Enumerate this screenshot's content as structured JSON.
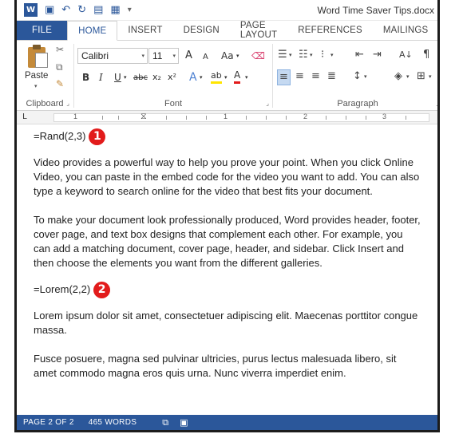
{
  "app": {
    "title": "Word Time Saver Tips.docx",
    "logo_letter": "W"
  },
  "qat": {
    "save_icon": "▣",
    "undo_icon": "↶",
    "redo_icon": "↻",
    "print_icon": "▤",
    "table_icon": "▦",
    "customize_icon": "▾"
  },
  "tabs": [
    {
      "label": "FILE"
    },
    {
      "label": "HOME"
    },
    {
      "label": "INSERT"
    },
    {
      "label": "DESIGN"
    },
    {
      "label": "PAGE LAYOUT"
    },
    {
      "label": "REFERENCES"
    },
    {
      "label": "MAILINGS"
    }
  ],
  "ribbon": {
    "clipboard": {
      "label": "Clipboard",
      "paste_label": "Paste",
      "dropdown_arrow": "▾",
      "cut_icon": "✂",
      "copy_icon": "⧉",
      "format_painter_icon": "✎",
      "launcher": "⌟"
    },
    "font": {
      "label": "Font",
      "font_name": "Calibri",
      "font_size": "11",
      "grow": "A",
      "shrink": "A",
      "change_case": "Aa",
      "clear_format_icon": "⌫",
      "bold": "B",
      "italic": "I",
      "underline": "U",
      "strikethrough": "abc",
      "subscript": "x₂",
      "superscript": "x²",
      "text_effects": "A",
      "highlight": "ab",
      "font_color": "A",
      "dd": "▾",
      "launcher": "⌟"
    },
    "paragraph": {
      "label": "Paragraph",
      "bullets_icon": "☰",
      "numbering_icon": "☷",
      "multilevel_icon": "⁝",
      "decrease_indent_icon": "⇤",
      "increase_indent_icon": "⇥",
      "sort_icon": "A↓",
      "pilcrow": "¶",
      "align_left_icon": "≡",
      "center_icon": "≡",
      "align_right_icon": "≡",
      "justify_icon": "≣",
      "line_spacing_icon": "↕",
      "shading_icon": "◈",
      "borders_icon": "⊞",
      "dd": "▾",
      "launcher": "⌟"
    }
  },
  "ruler": {
    "tab_selector": "L",
    "numbers": [
      "1",
      "1",
      "2",
      "3"
    ],
    "indent_marker": "⧖"
  },
  "document": {
    "formula1": "=Rand(2,3)",
    "badge1": "1",
    "paragraph1": "Video provides a powerful way to help you prove your point. When you click Online Video, you can paste in the embed code for the video you want to add. You can also type a keyword to search online for the video that best fits your document.",
    "paragraph2": "To make your document look professionally produced, Word provides header, footer, cover page, and text box designs that complement each other. For example, you can add a matching document, cover page, header, and sidebar. Click Insert and then choose the elements you want from the different galleries.",
    "formula2": "=Lorem(2,2)",
    "badge2": "2",
    "paragraph3": "Lorem ipsum dolor sit amet, consectetuer adipiscing elit. Maecenas porttitor congue massa.",
    "paragraph4": "Fusce posuere, magna sed pulvinar ultricies, purus lectus malesuada libero, sit amet commodo magna eros quis urna. Nunc viverra imperdiet enim."
  },
  "status": {
    "page": "PAGE 2 OF 2",
    "words": "465 WORDS",
    "proofing_icon": "⧉",
    "macro_icon": "▣"
  },
  "colors": {
    "accent": "#2b579a",
    "badge": "#e21b1b"
  }
}
